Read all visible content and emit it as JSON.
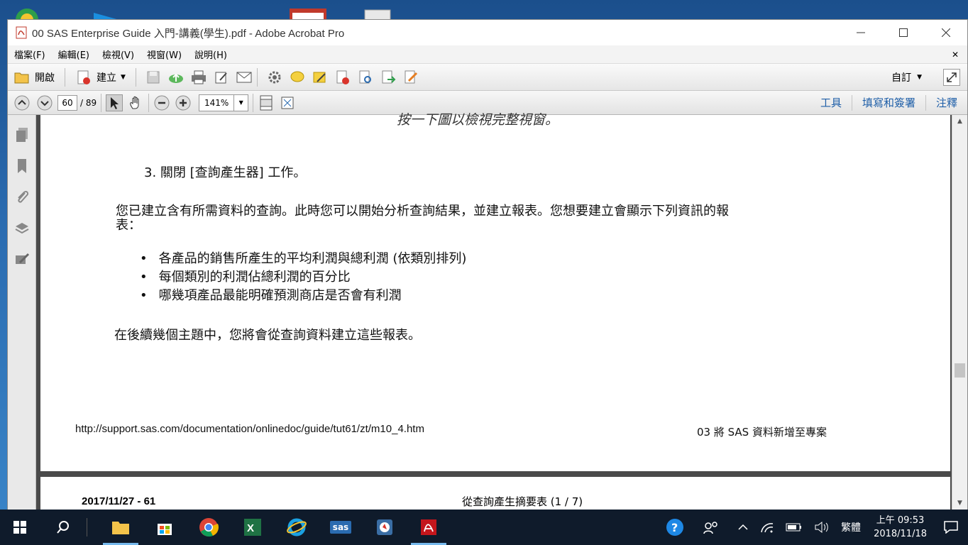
{
  "window": {
    "title": "00 SAS Enterprise Guide 入門-講義(學生).pdf - Adobe Acrobat Pro"
  },
  "menu": [
    "檔案(F)",
    "編輯(E)",
    "檢視(V)",
    "視窗(W)",
    "說明(H)"
  ],
  "toolbar": {
    "open_label": "開啟",
    "create_label": "建立",
    "customize_label": "自訂"
  },
  "nav": {
    "current_page": "60",
    "total_pages": "/ 89",
    "zoom": "141%",
    "links": [
      "工具",
      "填寫和簽署",
      "注釋"
    ]
  },
  "document": {
    "top_cut_text": "按一下圖以檢視完整視窗。",
    "step3": "3. 關閉 [查詢產生器] 工作。",
    "para1_line1": "您已建立含有所需資料的查詢。此時您可以開始分析查詢結果，並建立報表。您想要建立會顯示下列資訊的報",
    "para1_line2": "表：",
    "bullets": [
      "各產品的銷售所產生的平均利潤與總利潤 (依類別排列)",
      "每個類別的利潤佔總利潤的百分比",
      "哪幾項產品最能明確預測商店是否會有利潤"
    ],
    "para2": "在後續幾個主題中，您將會從查詢資料建立這些報表。",
    "footer_url": "http://support.sas.com/documentation/onlinedoc/guide/tut61/zt/m10_4.htm",
    "footer_right": "03 將 SAS 資料新增至專案",
    "next_page_left": "2017/11/27 - 61",
    "next_page_center": "從查詢產生摘要表 (1 / 7)"
  },
  "taskbar": {
    "ime": "繁體",
    "time": "上午 09:53",
    "date": "2018/11/18",
    "sas_label": "sas"
  }
}
